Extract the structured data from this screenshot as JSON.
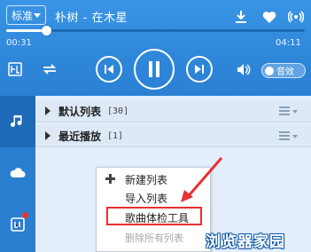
{
  "player": {
    "quality": "标准",
    "song": "朴树 - 在木星",
    "time_current": "00:31",
    "time_total": "04:11",
    "progress_fraction": 0.12,
    "sound_effect_label": "音效"
  },
  "icons": {
    "download": "download-icon",
    "favorite": "heart-icon",
    "broadcast": "broadcast-icon",
    "lyric": "lyric-icon",
    "loop": "loop-icon",
    "prev": "previous-icon",
    "pause": "pause-icon",
    "next": "next-icon",
    "volume": "volume-icon"
  },
  "sidebar": {
    "items": [
      {
        "icon": "music-note-icon"
      },
      {
        "icon": "cloud-icon"
      },
      {
        "icon": "live-icon"
      }
    ]
  },
  "playlists": [
    {
      "name": "默认列表",
      "count": "[30]"
    },
    {
      "name": "最近播放",
      "count": "[1]"
    }
  ],
  "context_menu": {
    "items": [
      {
        "label": "新建列表"
      },
      {
        "label": "导入列表"
      },
      {
        "label": "歌曲体检工具"
      },
      {
        "label": "删除所有列表"
      }
    ]
  },
  "watermark": "浏览器家园",
  "colors": {
    "primary": "#2f87da",
    "highlight": "#e53131"
  }
}
